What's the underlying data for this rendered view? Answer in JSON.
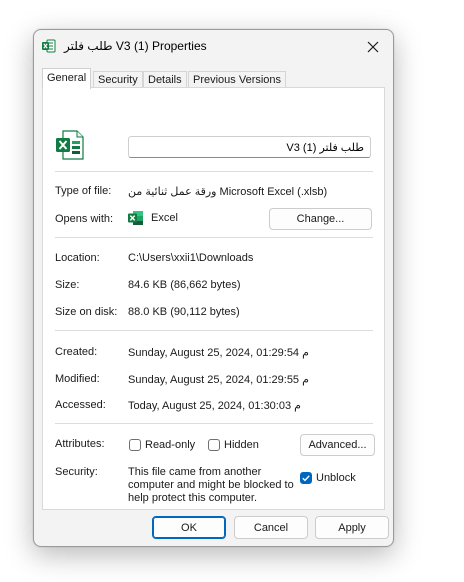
{
  "window": {
    "title": "طلب فلتر V3 (1) Properties",
    "close_icon": "close-icon"
  },
  "tabs": [
    {
      "label": "General",
      "active": true
    },
    {
      "label": "Security",
      "active": false
    },
    {
      "label": "Details",
      "active": false
    },
    {
      "label": "Previous Versions",
      "active": false
    }
  ],
  "general": {
    "file_name": "طلب فلتر V3 (1)",
    "type_label": "Type of file:",
    "type_value": "ورقة عمل ثنائية من Microsoft Excel (.xlsb)",
    "opens_label": "Opens with:",
    "opens_value": "Excel",
    "change_label": "Change...",
    "location_label": "Location:",
    "location_value": "C:\\Users\\xxii1\\Downloads",
    "size_label": "Size:",
    "size_value": "84.6 KB (86,662 bytes)",
    "size_disk_label": "Size on disk:",
    "size_disk_value": "88.0 KB (90,112 bytes)",
    "created_label": "Created:",
    "created_value": "Sunday, August 25, 2024, 01:29:54 م",
    "modified_label": "Modified:",
    "modified_value": "Sunday, August 25, 2024, 01:29:55 م",
    "accessed_label": "Accessed:",
    "accessed_value": "Today, August 25, 2024, 01:30:03 م",
    "attributes_label": "Attributes:",
    "readonly_label": "Read-only",
    "readonly_checked": false,
    "hidden_label": "Hidden",
    "hidden_checked": false,
    "advanced_label": "Advanced...",
    "security_label": "Security:",
    "security_line1": "This file came from another",
    "security_line2": "computer and might be blocked to",
    "security_line3": "help protect this computer.",
    "unblock_label": "Unblock",
    "unblock_checked": true
  },
  "footer": {
    "ok_label": "OK",
    "cancel_label": "Cancel",
    "apply_label": "Apply"
  },
  "colors": {
    "excel_green": "#107c41",
    "accent_blue": "#0067c0"
  }
}
